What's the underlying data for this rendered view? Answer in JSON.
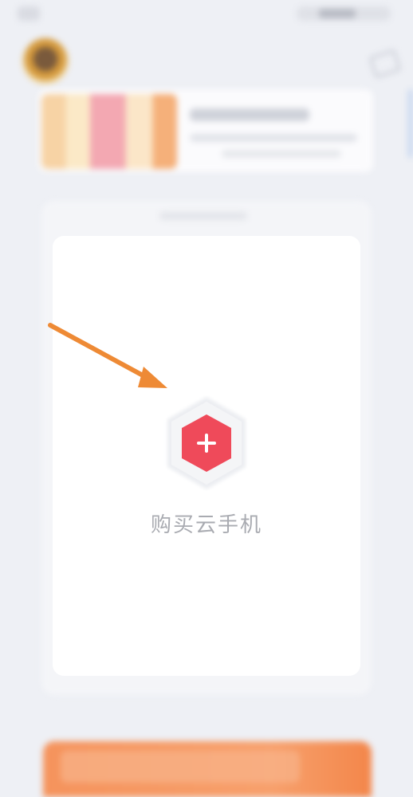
{
  "buy_cloud_phone": {
    "label": "购买云手机"
  },
  "colors": {
    "accent_red": "#ef4a5a",
    "annotation_arrow": "#ee8a35",
    "bottom_bar": "#f5935c"
  },
  "icons": {
    "plus": "plus-icon",
    "avatar": "avatar",
    "top_right": "edit-icon"
  }
}
